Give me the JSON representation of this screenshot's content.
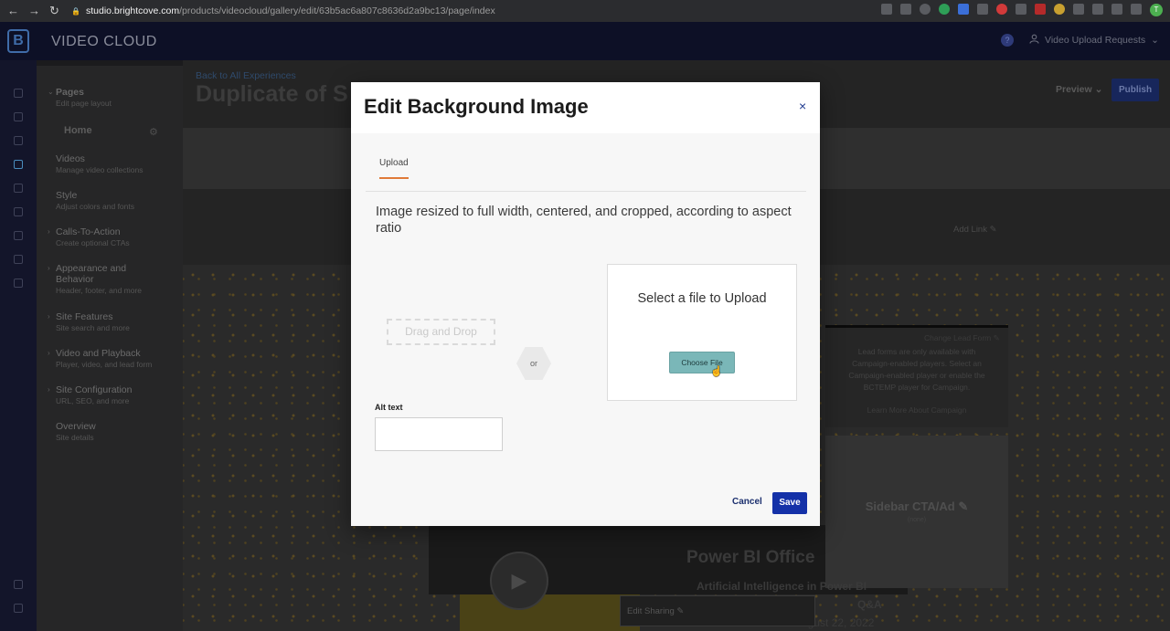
{
  "browser": {
    "url_host": "studio.brightcove.com",
    "url_path": "/products/videocloud/gallery/edit/63b5ac6a807c8636d2a9bc13/page/index",
    "back_icon": "←",
    "forward_icon": "→",
    "reload_icon": "↻",
    "lock_icon": "🔒",
    "profile_initial": "T"
  },
  "app": {
    "brand": "VIDEO CLOUD",
    "logo_letter": "B",
    "help": "?",
    "user_label": "Video Upload Requests",
    "user_icon": "person-icon"
  },
  "sidebar": {
    "items": [
      {
        "title": "Pages",
        "sub": "Edit page layout"
      },
      {
        "title": "Videos",
        "sub": "Manage video collections"
      },
      {
        "title": "Style",
        "sub": "Adjust colors and fonts"
      },
      {
        "title": "Calls-To-Action",
        "sub": "Create optional CTAs"
      },
      {
        "title": "Appearance and Behavior",
        "sub": "Header, footer, and more"
      },
      {
        "title": "Site Features",
        "sub": "Site search and more"
      },
      {
        "title": "Video and Playback",
        "sub": "Player, video, and lead form"
      },
      {
        "title": "Site Configuration",
        "sub": "URL, SEO, and more"
      },
      {
        "title": "Overview",
        "sub": "Site details"
      }
    ],
    "home": "Home"
  },
  "page": {
    "back_link": "Back to All Experiences",
    "title": "Duplicate of S",
    "preview": "Preview",
    "publish": "Publish",
    "add_link": "Add Link",
    "change_lead_form": "Change Lead Form",
    "lead_msg": "Lead forms are only available with Campaign-enabled players. Select an Campaign-enabled player or enable the BCTEMP player for Campaign.",
    "learn_more": "Learn More About Campaign",
    "sidebar_cta": "Sidebar CTA/Ad",
    "sidebar_cta_sub": "(none)",
    "video_title": "Power BI Office",
    "video_sub": "Artificial Intelligence in Power BI",
    "qa": "Q&A",
    "date": "August 22, 2022",
    "edit_sharing": "Edit Sharing"
  },
  "modal": {
    "title": "Edit Background Image",
    "close": "×",
    "tab": "Upload",
    "description": "Image resized to full width, centered, and cropped, according to aspect ratio",
    "drag_drop": "Drag and Drop",
    "or": "or",
    "select_file": "Select a file to Upload",
    "choose_file": "Choose File",
    "alt_label": "Alt text",
    "alt_value": "",
    "cancel": "Cancel",
    "save": "Save"
  }
}
